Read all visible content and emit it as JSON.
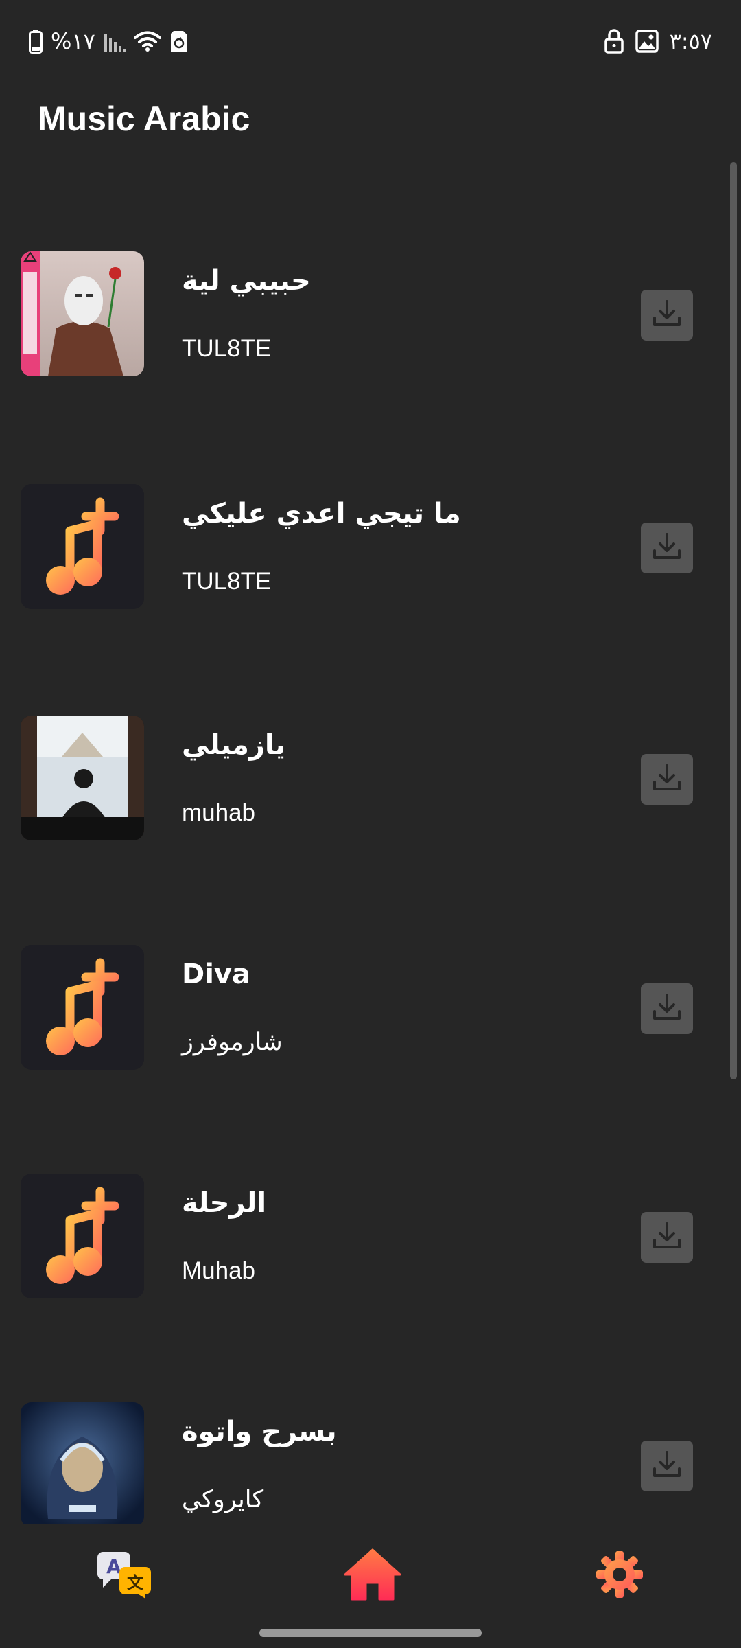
{
  "status_bar": {
    "battery": "%١٧",
    "time": "٣:٥٧",
    "icons_left": [
      "battery-icon",
      "signal-icon",
      "wifi-icon",
      "sim-recycle-icon"
    ],
    "icons_right": [
      "lock-icon",
      "image-icon"
    ]
  },
  "header": {
    "title": "Music Arabic"
  },
  "songs": [
    {
      "title": "حبيبي لية",
      "artist": "TUL8TE",
      "thumbnail": "album-art-masked-figure",
      "action_icon": "download-icon"
    },
    {
      "title": "ما تيجي اعدي عليكي",
      "artist": "TUL8TE",
      "thumbnail": "music-note-plus-icon",
      "action_icon": "download-icon"
    },
    {
      "title": "يازميلي",
      "artist": "muhab",
      "thumbnail": "album-art-window-silhouette",
      "action_icon": "download-icon"
    },
    {
      "title": "Diva",
      "artist": "شارموفرز",
      "thumbnail": "music-note-plus-icon",
      "action_icon": "download-icon"
    },
    {
      "title": "الرحلة",
      "artist": "Muhab",
      "thumbnail": "music-note-plus-icon",
      "action_icon": "download-icon"
    },
    {
      "title": "بسرح واتوة",
      "artist": "كايروكي",
      "thumbnail": "album-art-blue-portrait",
      "action_icon": "download-icon"
    }
  ],
  "bottom_nav": {
    "items": [
      "translate-icon",
      "home-icon",
      "settings-icon"
    ]
  },
  "colors": {
    "background": "#262626",
    "download_button": "#555555",
    "accent_gradient_start": "#ffb347",
    "accent_gradient_end": "#ff6b5a",
    "home_red": "#ff4f4f"
  }
}
